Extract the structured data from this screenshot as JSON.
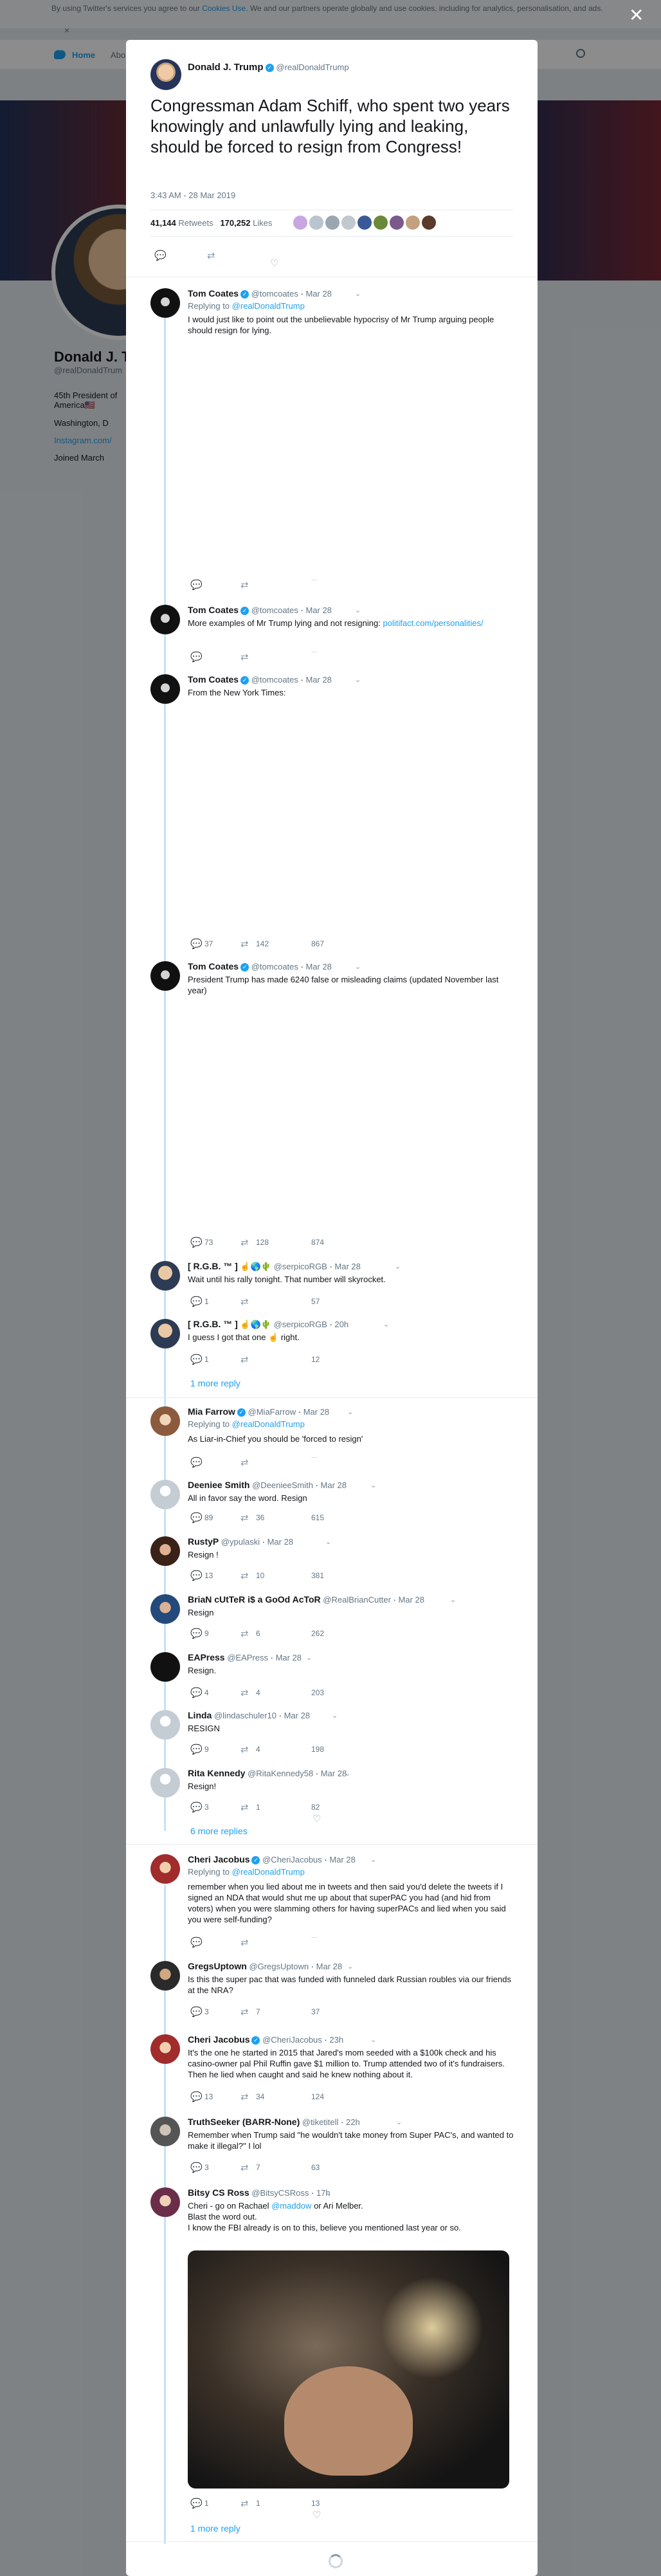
{
  "cookie": {
    "prefix": "By using Twitter's services you agree to our",
    "link": "Cookies Use",
    "suffix": ". We and our partners operate globally and use cookies, including for analytics, personalisation, and ads."
  },
  "topnav": {
    "home": "Home",
    "about": "Abo"
  },
  "background_profile": {
    "name": "Donald J. T",
    "handle": "@realDonaldTrum",
    "bio": "45th President of",
    "bio2": "America🇺🇸",
    "location": "Washington, D",
    "url": "Instagram.com/",
    "joined": "Joined March"
  },
  "main": {
    "name": "Donald J. Trump",
    "handle": "@realDonaldTrump",
    "text": "Congressman Adam Schiff, who spent two years knowingly and unlawfully lying and leaking, should be forced to resign from Congress!",
    "time": "3:43 AM - 28 Mar 2019",
    "retweets": "41,144",
    "retweets_label": "Retweets",
    "likes": "170,252",
    "likes_label": "Likes"
  },
  "replies": [
    {
      "name": "Tom Coates",
      "handle": "@tomcoates",
      "date": "Mar 28",
      "replying": "Replying to",
      "replying_to": "@realDonaldTrump",
      "text": "I would just like to point out the unbelievable hypocrisy of Mr Trump arguing people should resign for lying."
    },
    {
      "name": "Tom Coates",
      "handle": "@tomcoates",
      "date": "Mar 28",
      "text": "More examples of Mr Trump lying and not resigning:",
      "link": "politifact.com/personalities/"
    },
    {
      "name": "Tom Coates",
      "handle": "@tomcoates",
      "date": "Mar 28",
      "text": "From the New York Times:",
      "c_reply": "37",
      "c_rt": "142",
      "c_like": "867"
    },
    {
      "name": "Tom Coates",
      "handle": "@tomcoates",
      "date": "Mar 28",
      "text": "President Trump has made 6240 false or misleading claims (updated November last year)",
      "c_reply": "73",
      "c_rt": "128",
      "c_like": "874"
    },
    {
      "name": "[ R.G.B. ™ ]",
      "handle": "@serpicoRGB",
      "date": "Mar 28",
      "text": "Wait until his rally tonight. That number will skyrocket.",
      "c_reply": "1",
      "c_like": "57"
    },
    {
      "name": "[ R.G.B. ™ ]",
      "handle": "@serpicoRGB",
      "date": "20h",
      "text": "I guess I got that one ☝️ right.",
      "c_reply": "1",
      "c_like": "12"
    },
    {
      "more": "1 more reply"
    },
    {
      "name": "Mia Farrow",
      "handle": "@MiaFarrow",
      "date": "Mar 28",
      "replying": "Replying to",
      "replying_to": "@realDonaldTrump",
      "text": "As Liar-in-Chief you should be 'forced to resign'"
    },
    {
      "name": "Deeniee Smith",
      "handle": "@DeenieeSmith",
      "date": "Mar 28",
      "text": "All in favor say the word.  Resign",
      "c_reply": "89",
      "c_rt": "36",
      "c_like": "615"
    },
    {
      "name": "RustyP",
      "handle": "@ypulaski",
      "date": "Mar 28",
      "text": "Resign !",
      "c_reply": "13",
      "c_rt": "10",
      "c_like": "381"
    },
    {
      "name": "BriaN cUtTeR i$ a GoOd AcToR",
      "handle": "@RealBrianCutter",
      "date": "Mar 28",
      "text": "Resign",
      "c_reply": "9",
      "c_rt": "6",
      "c_like": "262"
    },
    {
      "name": "EAPress",
      "handle": "@EAPress",
      "date": "Mar 28",
      "text": "Resign.",
      "c_reply": "4",
      "c_rt": "4",
      "c_like": "203"
    },
    {
      "name": "Linda",
      "handle": "@lindaschuler10",
      "date": "Mar 28",
      "text": "RESIGN",
      "c_reply": "9",
      "c_rt": "4",
      "c_like": "198"
    },
    {
      "name": "Rita Kennedy",
      "handle": "@RitaKennedy58",
      "date": "Mar 28",
      "text": "Resign!",
      "c_reply": "3",
      "c_rt": "1",
      "c_like": "82"
    },
    {
      "more": "6 more replies"
    },
    {
      "name": "Cheri Jacobus",
      "handle": "@CheriJacobus",
      "date": "Mar 28",
      "replying": "Replying to",
      "replying_to": "@realDonaldTrump",
      "text": "remember when you lied about me in tweets and then said you'd delete the tweets if I signed an NDA that would shut me up about that superPAC you had (and hid from voters) when you were slamming others for having superPACs and lied when you said you were self-funding?"
    },
    {
      "name": "GregsUptown",
      "handle": "@GregsUptown",
      "date": "Mar 28",
      "text": "Is this the super pac that was funded with funneled dark Russian roubles via our friends at the NRA?",
      "c_reply": "3",
      "c_rt": "7",
      "c_like": "37"
    },
    {
      "name": "Cheri Jacobus",
      "handle": "@CheriJacobus",
      "date": "23h",
      "text": "It's the one he started in 2015 that Jared's mom seeded with a $100k check and his casino-owner pal Phil Ruffin gave $1 million to.  Trump attended two of it's fundraisers.  Then he lied when caught and said he knew nothing about it.",
      "c_reply": "13",
      "c_rt": "34",
      "c_like": "124"
    },
    {
      "name": "TruthSeeker (BARR-None)",
      "handle": "@tiketitell",
      "date": "22h",
      "text": "Remember when Trump said \"he wouldn't take money from Super PAC's, and wanted to make it illegal?\" I lol",
      "c_reply": "3",
      "c_rt": "7",
      "c_like": "63"
    },
    {
      "name": "Bitsy CS Ross",
      "handle": "@BitsyCSRoss",
      "date": "17h",
      "text": "Cheri - go on Rachael",
      "mention": "@maddow",
      "text_b": "or Ari Melber.",
      "line2": "Blast the word out.",
      "line3": "I know the FBI already is on to this, believe you mentioned last year or so.",
      "c_reply": "1",
      "c_rt": "1",
      "c_like": "13"
    },
    {
      "more": "1 more reply"
    }
  ]
}
